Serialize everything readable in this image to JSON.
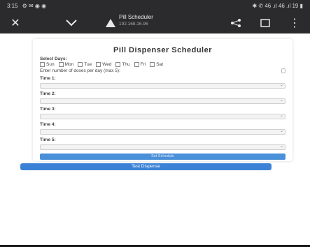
{
  "statusbar": {
    "time": "3:15",
    "right": "✱ ✆ 46 .ıl 46 .ıl 19 ▮"
  },
  "toolbar": {
    "title": "Pill Scheduler",
    "subtitle": "192.168.16.96"
  },
  "scheduler": {
    "title": "Pill Dispenser Scheduler",
    "select_days_label": "Select Days:",
    "days": [
      "Sun",
      "Mon",
      "Tue",
      "Wed",
      "Thu",
      "Fri",
      "Sat"
    ],
    "doses_label": "Enter number of doses per day (max 5):",
    "times": [
      {
        "label": "Time 1:"
      },
      {
        "label": "Time 2:"
      },
      {
        "label": "Time 3:"
      },
      {
        "label": "Time 4:"
      },
      {
        "label": "Time 5:"
      }
    ],
    "set_button": "Set Schedule"
  },
  "test_button": "Test Dispense"
}
